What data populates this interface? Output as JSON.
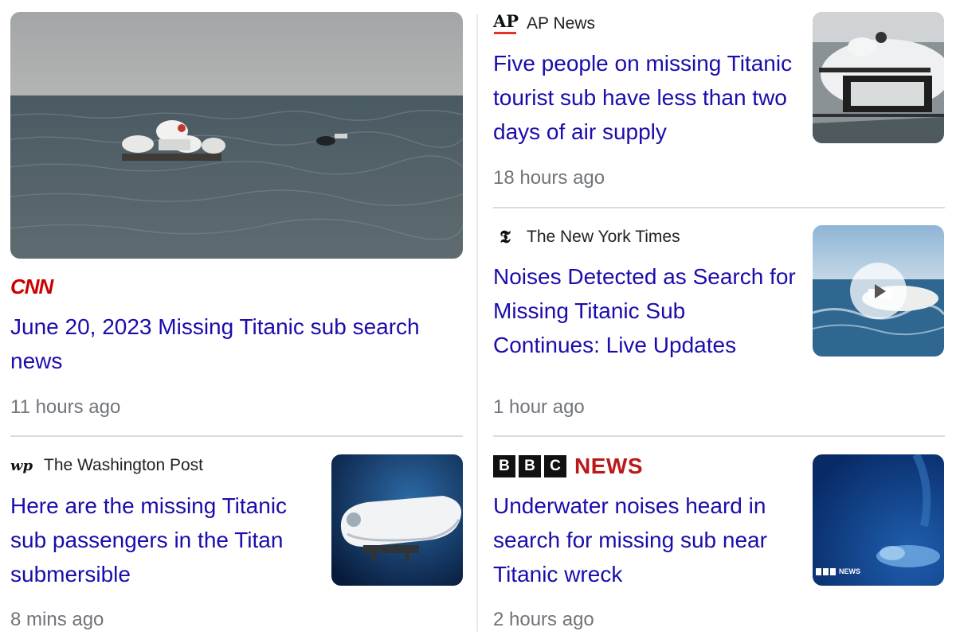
{
  "articles": [
    {
      "source": "CNN",
      "logo_text": "CNN",
      "headline": "June 20, 2023 Missing Titanic sub search news",
      "time": "11 hours ago",
      "thumbnail": "ocean-surface-with-submersible-platform"
    },
    {
      "source": "AP News",
      "logo_text": "AP",
      "headline": "Five people on missing Titanic tourist sub have less than two days of air supply",
      "time": "18 hours ago",
      "thumbnail": "submersible-on-ship-deck"
    },
    {
      "source": "The New York Times",
      "logo_text": "𝕿",
      "headline": "Noises Detected as Search for Missing Titanic Sub Continues: Live Updates",
      "time": "1 hour ago",
      "thumbnail": "submersible-at-sea-video",
      "has_video": true
    },
    {
      "source": "The Washington Post",
      "logo_text": "wp",
      "headline": "Here are the missing Titanic sub passengers in the Titan submersible",
      "time": "8 mins ago",
      "thumbnail": "titan-submersible-underwater"
    },
    {
      "source": "BBC News",
      "logo_letters": [
        "B",
        "B",
        "C"
      ],
      "logo_word": "NEWS",
      "headline": "Underwater noises heard in search for missing sub near Titanic wreck",
      "time": "2 hours ago",
      "thumbnail": "deep-sea-submersible",
      "watermark": "NEWS"
    }
  ],
  "colors": {
    "headline": "#1a0dab",
    "time": "#70757a",
    "cnn_red": "#cc0000",
    "bbc_red": "#bb1919",
    "ap_red": "#e5332a"
  }
}
